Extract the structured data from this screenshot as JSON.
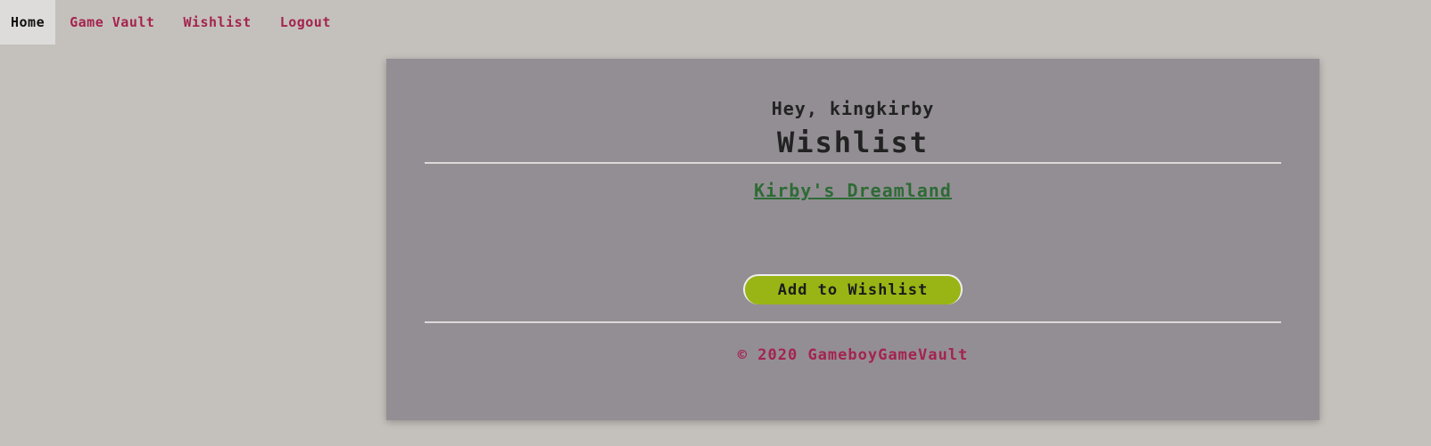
{
  "nav": {
    "home": "Home",
    "game_vault": "Game Vault",
    "wishlist": "Wishlist",
    "logout": "Logout"
  },
  "main": {
    "greeting": "Hey, kingkirby",
    "title": "Wishlist",
    "wishlist_items": [
      "Kirby's Dreamland"
    ],
    "add_button_label": "Add to Wishlist"
  },
  "footer": {
    "text": "© 2020 GameboyGameVault"
  },
  "colors": {
    "background": "#c4c1bc",
    "panel": "#938e94",
    "accent": "#a4234f",
    "link": "#2d6b35",
    "button": "#99b515"
  }
}
